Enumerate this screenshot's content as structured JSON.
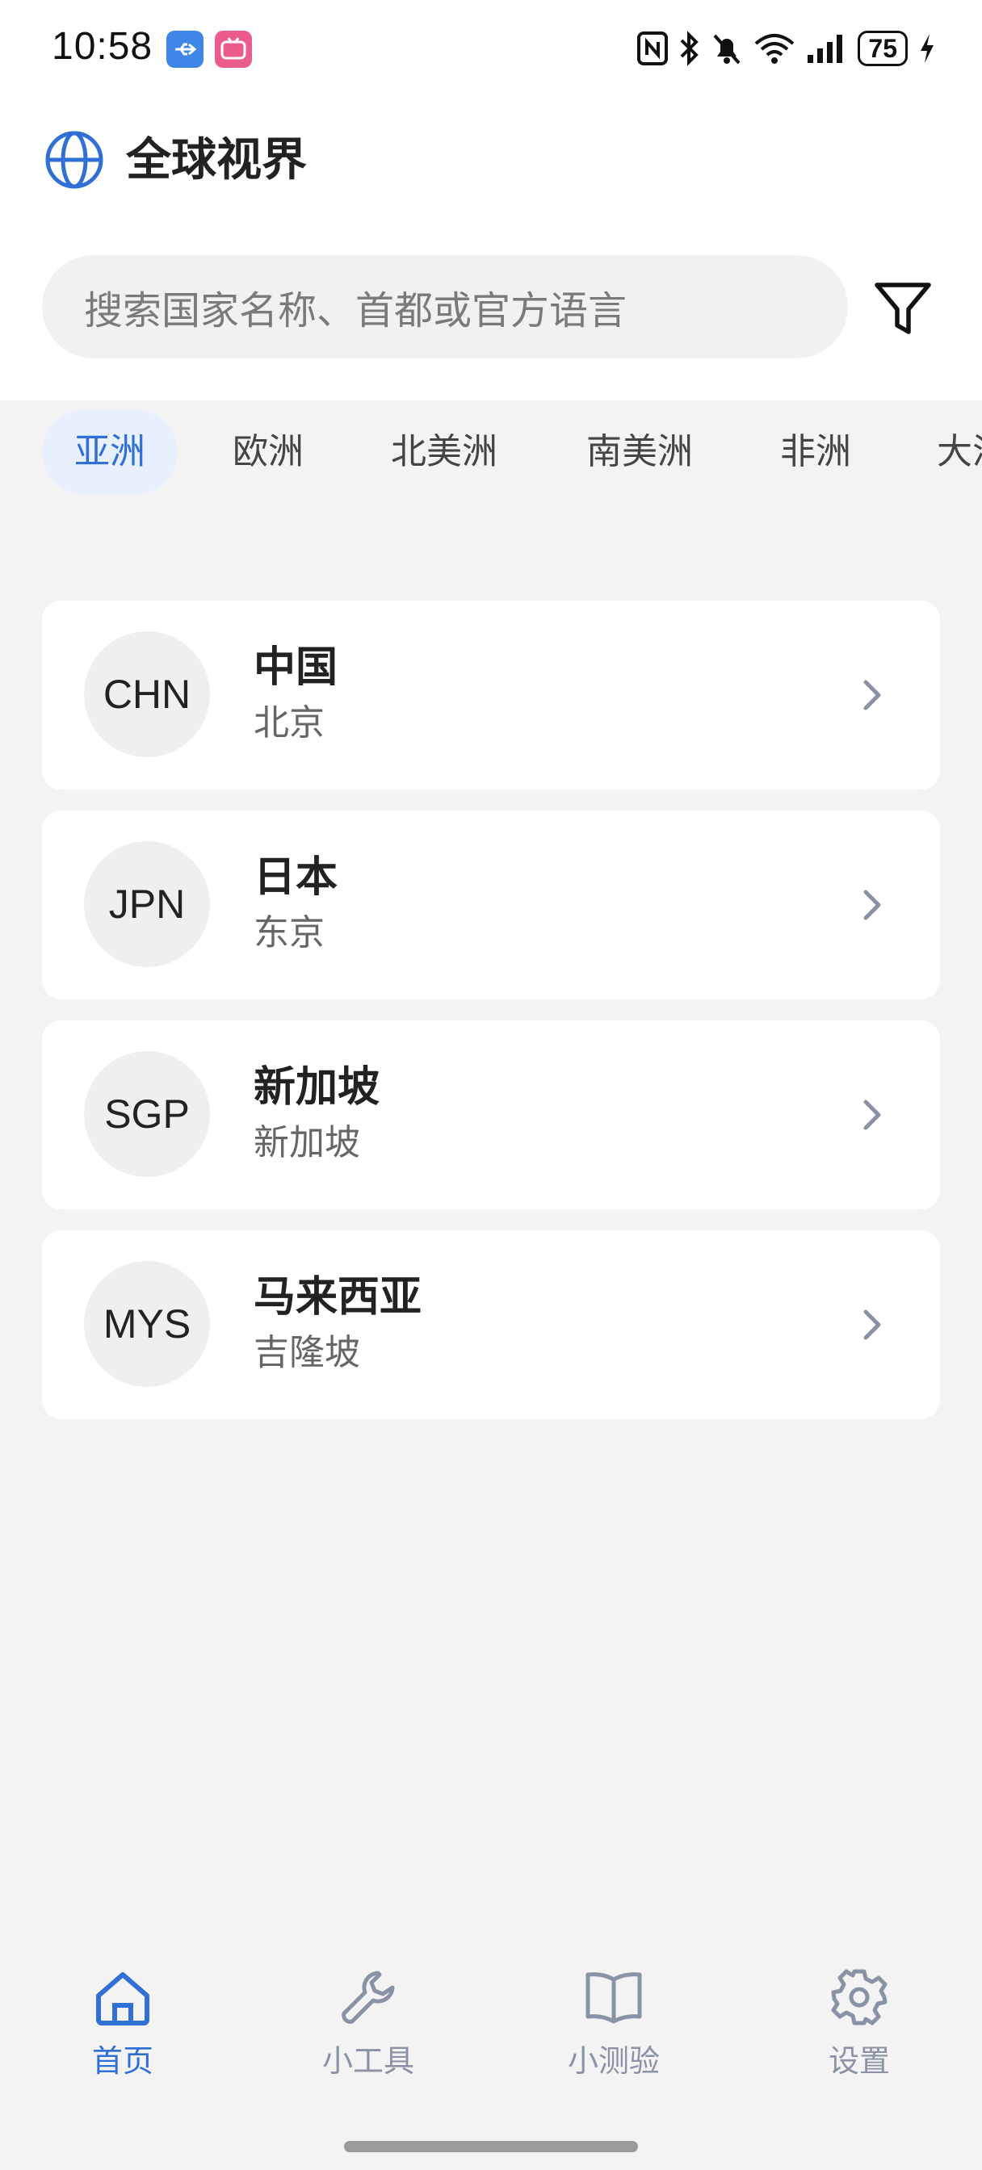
{
  "status_bar": {
    "time": "10:58",
    "battery": "75"
  },
  "header": {
    "title": "全球视界"
  },
  "search": {
    "placeholder": "搜索国家名称、首都或官方语言"
  },
  "tabs": [
    {
      "label": "亚洲",
      "active": true
    },
    {
      "label": "欧洲",
      "active": false
    },
    {
      "label": "北美洲",
      "active": false
    },
    {
      "label": "南美洲",
      "active": false
    },
    {
      "label": "非洲",
      "active": false
    },
    {
      "label": "大洋洲",
      "active": false
    }
  ],
  "countries": [
    {
      "code": "CHN",
      "name": "中国",
      "capital": "北京"
    },
    {
      "code": "JPN",
      "name": "日本",
      "capital": "东京"
    },
    {
      "code": "SGP",
      "name": "新加坡",
      "capital": "新加坡"
    },
    {
      "code": "MYS",
      "name": "马来西亚",
      "capital": "吉隆坡"
    }
  ],
  "bottom_nav": [
    {
      "label": "首页",
      "icon": "home-icon",
      "active": true
    },
    {
      "label": "小工具",
      "icon": "wrench-icon",
      "active": false
    },
    {
      "label": "小测验",
      "icon": "book-icon",
      "active": false
    },
    {
      "label": "设置",
      "icon": "gear-icon",
      "active": false
    }
  ],
  "colors": {
    "accent": "#2f6fd6",
    "inactive": "#8a93a6",
    "page_bg": "#f3f3f3"
  }
}
